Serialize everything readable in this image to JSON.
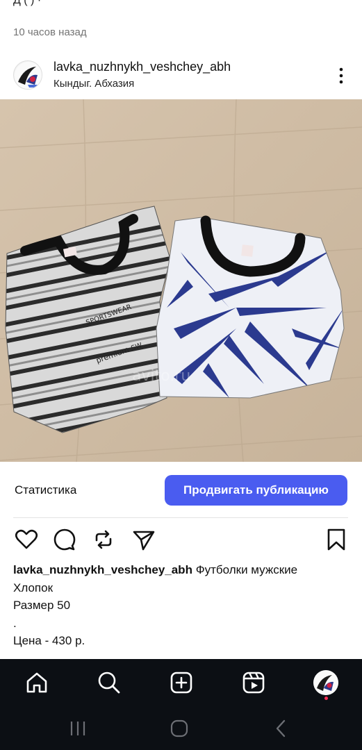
{
  "feed": {
    "prev_caption_fragment": "Д       (           )    ·",
    "timestamp": "10 часов назад"
  },
  "post": {
    "username": "lavka_nuzhnykh_veshchey_abh",
    "location": "Кындыг. Абхазия",
    "image": {
      "watermark": "avito.ru",
      "items": [
        "striped gray sportswear t-shirt",
        "white t-shirt with blue palm-leaf print"
      ],
      "shirt1_print_text": [
        "SPORTSWEAR",
        "premium",
        "SW"
      ]
    },
    "stats_label": "Статистика",
    "promote_label": "Продвигать публикацию",
    "caption": {
      "user": "lavka_nuzhnykh_veshchey_abh",
      "line1_rest": "Футболки мужские",
      "line2": "Хлопок",
      "line3": "Размер 50",
      "line4": ".",
      "line5": "Цена - 430 р."
    }
  },
  "actions": [
    "heart-icon",
    "comment-icon",
    "repost-icon",
    "share-icon",
    "bookmark-icon"
  ],
  "nav": [
    "home-icon",
    "search-icon",
    "create-icon",
    "reels-icon",
    "profile-avatar"
  ],
  "system_nav": [
    "recents-icon",
    "home-circle-icon",
    "back-icon"
  ],
  "colors": {
    "accent": "#4a5cf0",
    "nav_bg": "#0c0f14",
    "notification_dot": "#ff2d55"
  }
}
